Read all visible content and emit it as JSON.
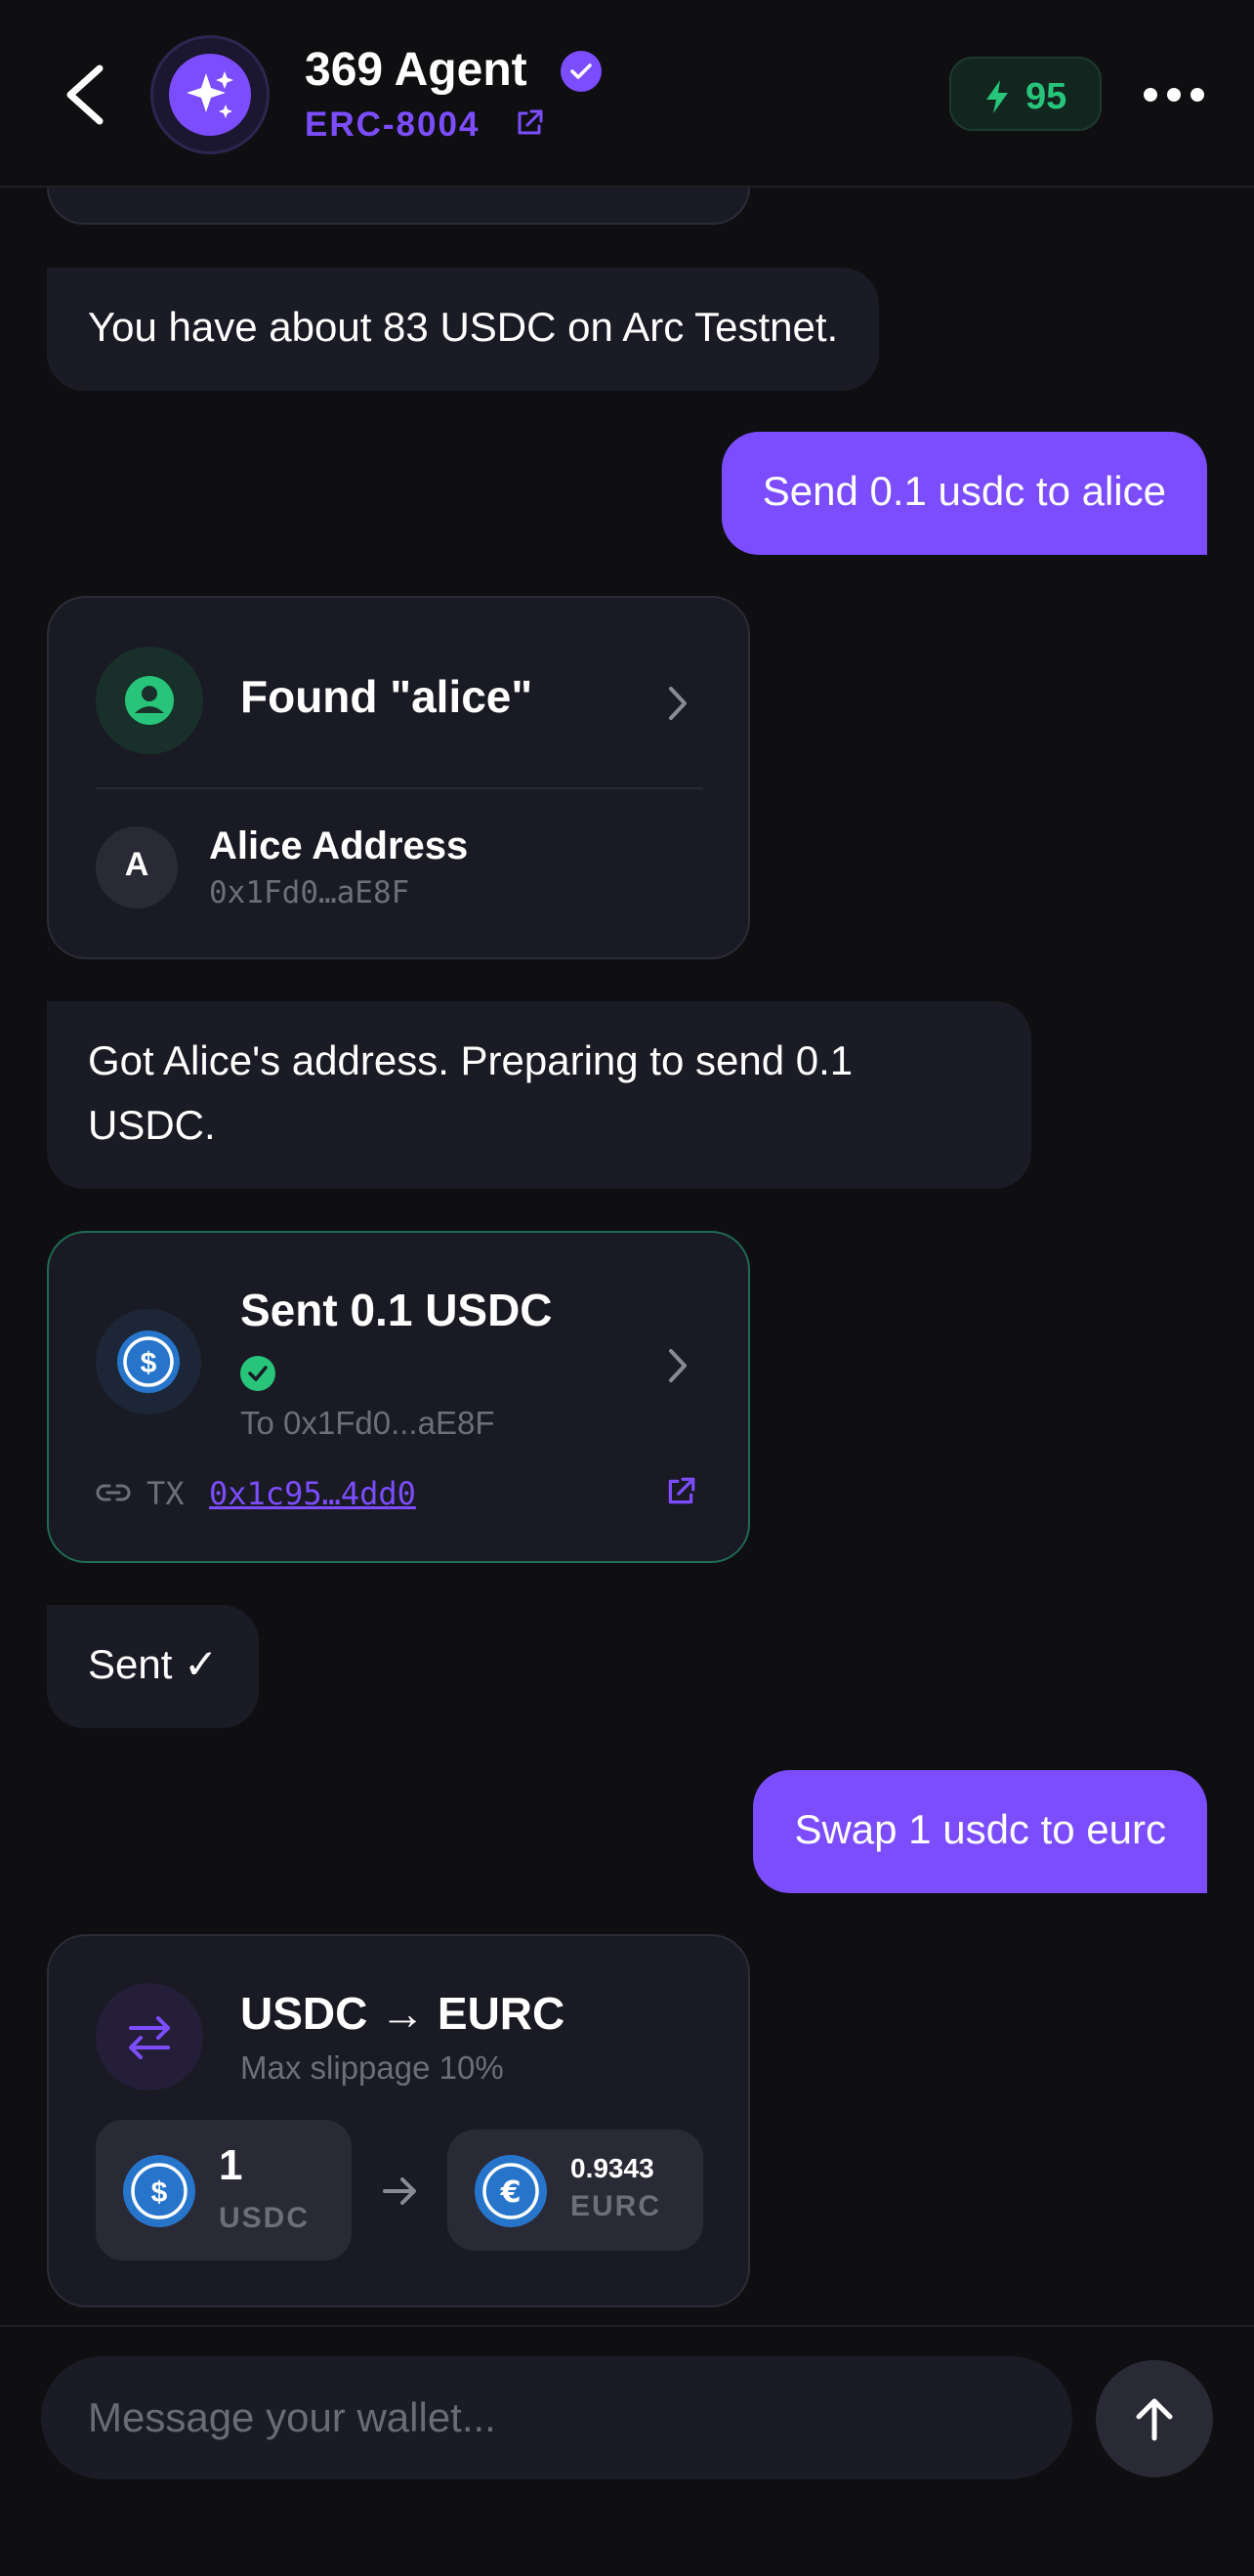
{
  "header": {
    "agent_name": "369 Agent",
    "standard_label": "ERC-8004",
    "score": "95"
  },
  "messages": {
    "balance": "You have about 83 USDC on Arc Testnet.",
    "user_send": "Send 0.1 usdc to alice",
    "got_address": "Got Alice's address. Preparing to send 0.1 USDC.",
    "sent": "Sent ✓",
    "user_swap": "Swap 1 usdc to eurc"
  },
  "contact_card": {
    "title": "Found \"alice\"",
    "initial": "A",
    "name": "Alice Address",
    "address": "0x1Fd0…aE8F"
  },
  "tx_card": {
    "title": "Sent 0.1 USDC",
    "to": "To 0x1Fd0...aE8F",
    "tx_label": "TX",
    "tx_hash": "0x1c95…4dd0"
  },
  "swap_card": {
    "title": "USDC → EURC",
    "subtitle": "Max slippage 10%",
    "from_amount": "1",
    "from_token": "USDC",
    "to_amount": "0.9343",
    "to_token": "EURC"
  },
  "composer": {
    "placeholder": "Message your wallet..."
  },
  "colors": {
    "accent": "#7c4dff",
    "success": "#27c47a",
    "usdc_blue": "#2775ca"
  }
}
